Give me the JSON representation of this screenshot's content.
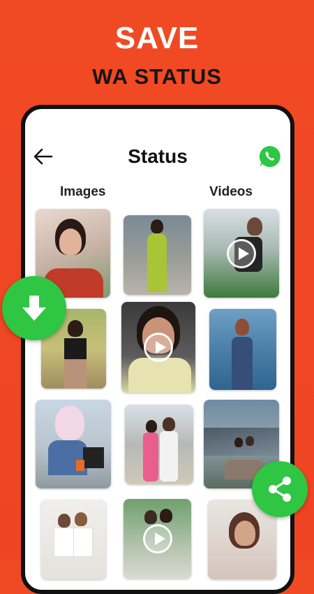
{
  "promo": {
    "headline_line1": "SAVE",
    "headline_line2": "WA STATUS"
  },
  "screen": {
    "title": "Status",
    "back_icon": "arrow-left-icon",
    "whatsapp_icon": "whatsapp-icon",
    "columns": [
      "Images",
      "Videos"
    ]
  },
  "grid": {
    "tiles": [
      {
        "type": "image",
        "description_icon": "photo"
      },
      {
        "type": "image",
        "description_icon": "photo"
      },
      {
        "type": "video",
        "description_icon": "play-icon"
      },
      {
        "type": "image",
        "description_icon": "photo"
      },
      {
        "type": "video",
        "description_icon": "play-icon"
      },
      {
        "type": "image",
        "description_icon": "photo"
      },
      {
        "type": "image",
        "description_icon": "photo"
      },
      {
        "type": "image",
        "description_icon": "photo"
      },
      {
        "type": "image",
        "description_icon": "photo"
      },
      {
        "type": "image",
        "description_icon": "photo"
      },
      {
        "type": "video",
        "description_icon": "play-icon"
      },
      {
        "type": "image",
        "description_icon": "photo"
      }
    ]
  },
  "actions": {
    "download_icon": "download-arrow-icon",
    "share_icon": "share-icon"
  },
  "colors": {
    "background": "#ef4623",
    "headline_primary": "#ffffff",
    "headline_secondary": "#151515",
    "fab_green": "#2ec643",
    "whatsapp_green": "#2ec643"
  }
}
